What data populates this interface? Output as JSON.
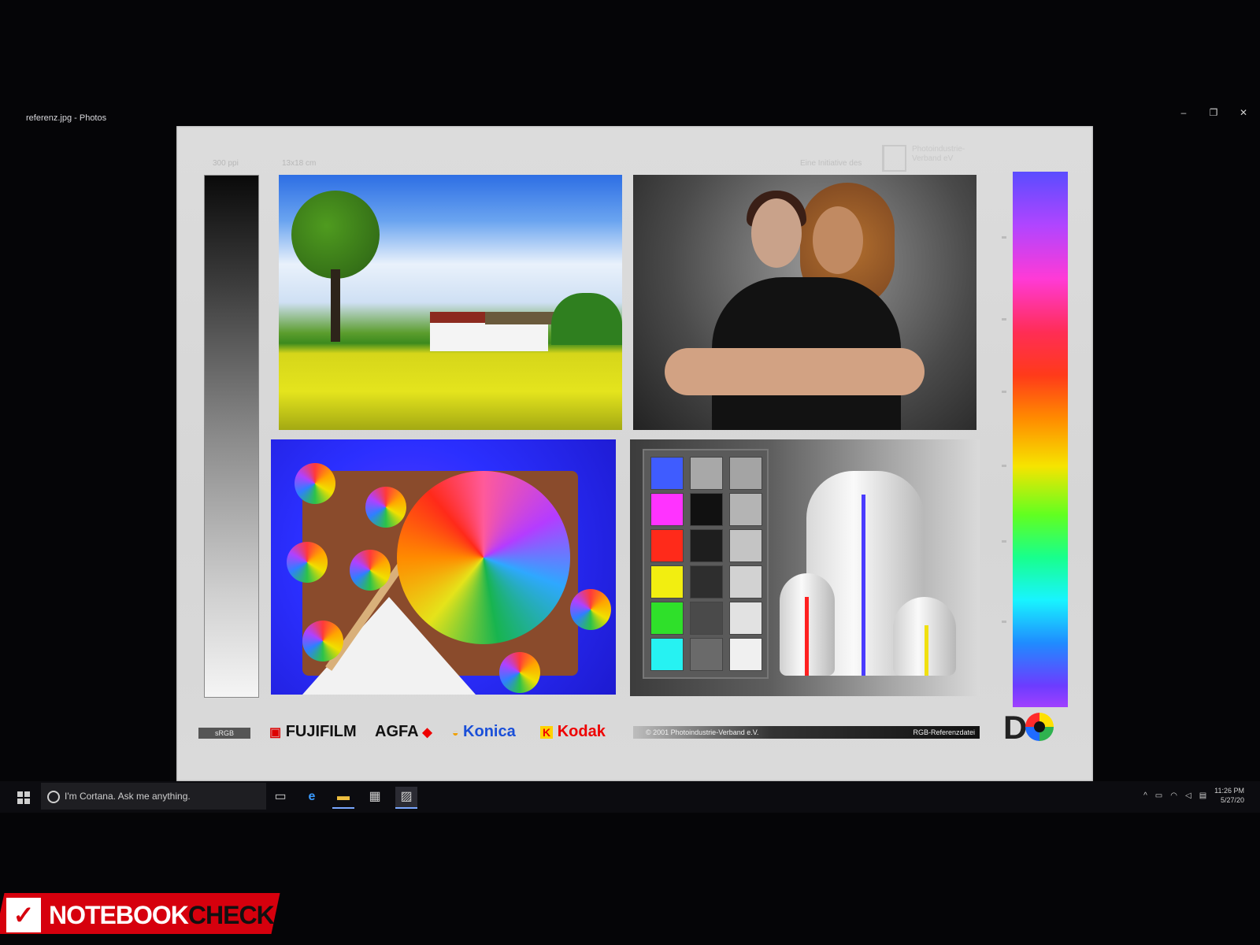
{
  "window": {
    "title": "referenz.jpg - Photos",
    "controls": {
      "minimize": "–",
      "restore": "❐",
      "close": "✕"
    }
  },
  "chart_labels": {
    "ppi": "300 ppi",
    "size": "13x18 cm",
    "initiative": "Eine Initiative des",
    "org_line1": "Photoindustrie-",
    "org_line2": "Verband eV"
  },
  "logos": {
    "srgb": "sRGB",
    "fujifilm": "FUJIFILM",
    "agfa": "AGFA",
    "konica": "Konica",
    "kodak": "Kodak",
    "dq": "D"
  },
  "copyright": {
    "left": "© 2001 Photoindustrie-Verband e.V.",
    "right": "RGB-Referenzdatei"
  },
  "patch_colors": {
    "col1": [
      "#3f5cff",
      "#ff33ff",
      "#ff2a1a",
      "#f2ee10",
      "#2fe02a",
      "#26f2f2"
    ],
    "col2": [
      "#a8a8a8",
      "#111111",
      "#1e1e1e",
      "#2e2e2e",
      "#4a4a4a",
      "#6a6a6a"
    ],
    "col3": [
      "#a4a4a4",
      "#b4b4b4",
      "#c4c4c4",
      "#d2d2d2",
      "#e2e2e2",
      "#f0f0f0"
    ]
  },
  "taskbar": {
    "cortana_placeholder": "I'm Cortana. Ask me anything.",
    "icons": [
      "task-view-icon",
      "edge-icon",
      "file-explorer-icon",
      "store-icon",
      "photos-icon"
    ],
    "time": "11:26 PM",
    "date": "5/27/20"
  },
  "watermark": {
    "notebook": "NOTEBOOK",
    "check": "CHECK"
  }
}
